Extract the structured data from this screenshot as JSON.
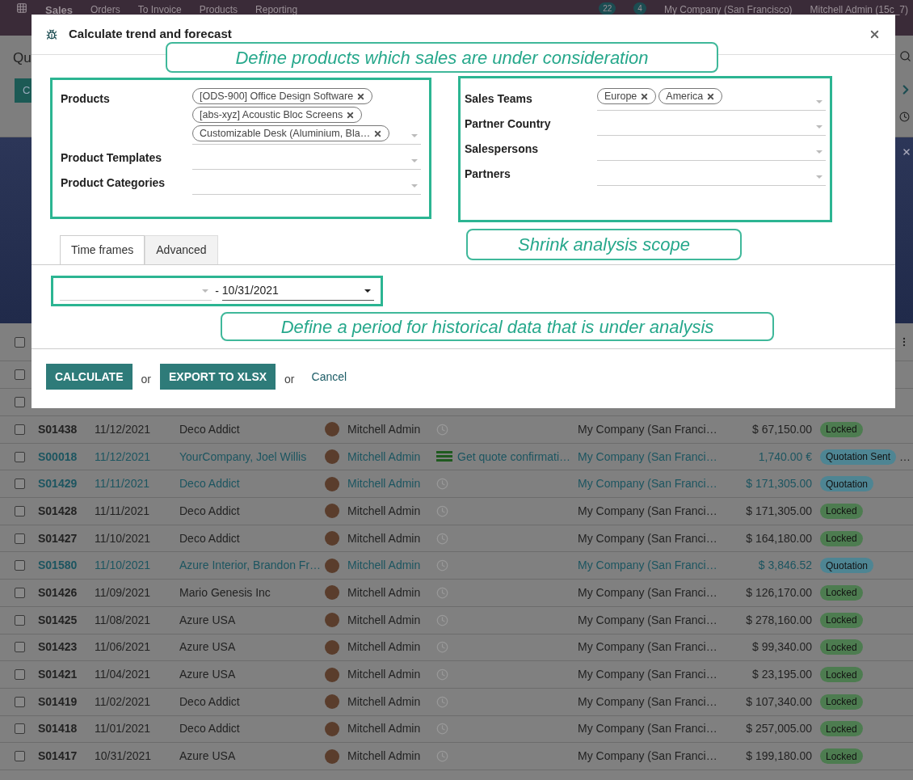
{
  "nav": {
    "app": "Sales",
    "menu": [
      "Orders",
      "To Invoice",
      "Products",
      "Reporting"
    ],
    "discuss_count": "22",
    "activity_count": "4",
    "company": "My Company (San Francisco)",
    "user": "Mitchell Admin (15c_7)"
  },
  "page": {
    "title": "Qu",
    "button": "C"
  },
  "table": {
    "header_checked": false,
    "hidden_rows": [
      {
        "checked": false
      },
      {
        "checked": false
      }
    ],
    "rows": [
      {
        "checked": false,
        "link": false,
        "number": "S01438",
        "date": "11/12/2021",
        "customer": "Deco Addict",
        "salesperson": "Mitchell Admin",
        "company": "My Company (San Franci…",
        "total": "$ 67,150.00",
        "status": "Locked",
        "color": "#4d7c50"
      },
      {
        "checked": false,
        "link": true,
        "number": "S00018",
        "date": "11/12/2021",
        "customer": "YourCompany, Joel Willis",
        "salesperson": "Mitchell Admin",
        "activity": "Get quote confirmati…",
        "company": "My Company (San Franci…",
        "total": "1,740.00 €",
        "status": "Quotation Sent",
        "color": "#4e8593",
        "more": "…"
      },
      {
        "checked": false,
        "link": true,
        "number": "S01429",
        "date": "11/11/2021",
        "customer": "Deco Addict",
        "salesperson": "Mitchell Admin",
        "company": "My Company (San Franci…",
        "total": "$ 171,305.00",
        "status": "Quotation",
        "color": "#4e8593"
      },
      {
        "checked": false,
        "link": false,
        "number": "S01428",
        "date": "11/11/2021",
        "customer": "Deco Addict",
        "salesperson": "Mitchell Admin",
        "company": "My Company (San Franci…",
        "total": "$ 171,305.00",
        "status": "Locked",
        "color": "#4d7c50"
      },
      {
        "checked": false,
        "link": false,
        "number": "S01427",
        "date": "11/10/2021",
        "customer": "Deco Addict",
        "salesperson": "Mitchell Admin",
        "company": "My Company (San Franci…",
        "total": "$ 164,180.00",
        "status": "Locked",
        "color": "#4d7c50"
      },
      {
        "checked": false,
        "link": true,
        "number": "S01580",
        "date": "11/10/2021",
        "customer": "Azure Interior, Brandon Fr…",
        "salesperson": "Mitchell Admin",
        "company": "My Company (San Franci…",
        "total": "$ 3,846.52",
        "status": "Quotation",
        "color": "#4e8593"
      },
      {
        "checked": false,
        "link": false,
        "number": "S01426",
        "date": "11/09/2021",
        "customer": "Mario Genesis Inc",
        "salesperson": "Mitchell Admin",
        "company": "My Company (San Franci…",
        "total": "$ 126,170.00",
        "status": "Locked",
        "color": "#4d7c50"
      },
      {
        "checked": false,
        "link": false,
        "number": "S01425",
        "date": "11/08/2021",
        "customer": "Azure USA",
        "salesperson": "Mitchell Admin",
        "company": "My Company (San Franci…",
        "total": "$ 278,160.00",
        "status": "Locked",
        "color": "#4d7c50"
      },
      {
        "checked": false,
        "link": false,
        "number": "S01423",
        "date": "11/06/2021",
        "customer": "Azure USA",
        "salesperson": "Mitchell Admin",
        "company": "My Company (San Franci…",
        "total": "$ 99,340.00",
        "status": "Locked",
        "color": "#4d7c50"
      },
      {
        "checked": false,
        "link": false,
        "number": "S01421",
        "date": "11/04/2021",
        "customer": "Azure USA",
        "salesperson": "Mitchell Admin",
        "company": "My Company (San Franci…",
        "total": "$ 23,195.00",
        "status": "Locked",
        "color": "#4d7c50"
      },
      {
        "checked": false,
        "link": false,
        "number": "S01419",
        "date": "11/02/2021",
        "customer": "Deco Addict",
        "salesperson": "Mitchell Admin",
        "company": "My Company (San Franci…",
        "total": "$ 107,340.00",
        "status": "Locked",
        "color": "#4d7c50"
      },
      {
        "checked": false,
        "link": false,
        "number": "S01418",
        "date": "11/01/2021",
        "customer": "Deco Addict",
        "salesperson": "Mitchell Admin",
        "company": "My Company (San Franci…",
        "total": "$ 257,005.00",
        "status": "Locked",
        "color": "#4d7c50"
      },
      {
        "checked": false,
        "link": false,
        "number": "S01417",
        "date": "10/31/2021",
        "customer": "Azure USA",
        "salesperson": "Mitchell Admin",
        "company": "My Company (San Franci…",
        "total": "$ 199,180.00",
        "status": "Locked",
        "color": "#4d7c50"
      }
    ]
  },
  "dialog": {
    "title": "Calculate trend and forecast",
    "left_fields": [
      {
        "label": "Products",
        "tags": [
          "[ODS-900] Office Design Software",
          "[abs-xyz] Acoustic Bloc Screens",
          "Customizable Desk (Aluminium, Bla…"
        ]
      },
      {
        "label": "Product Templates"
      },
      {
        "label": "Product Categories"
      }
    ],
    "right_fields": [
      {
        "label": "Sales Teams",
        "tags": [
          "Europe",
          "America"
        ]
      },
      {
        "label": "Partner Country"
      },
      {
        "label": "Salespersons"
      },
      {
        "label": "Partners"
      }
    ],
    "tabs": [
      {
        "label": "Time frames",
        "selected": true
      },
      {
        "label": "Advanced",
        "selected": false
      }
    ],
    "date_separator": "-",
    "date_to": "10/31/2021",
    "buttons": [
      {
        "label": "CALCULATE",
        "kind": "primary"
      },
      {
        "label": "or",
        "kind": "text"
      },
      {
        "label": "EXPORT TO XLSX",
        "kind": "primary"
      },
      {
        "label": "or",
        "kind": "text"
      },
      {
        "label": "Cancel",
        "kind": "link"
      }
    ]
  },
  "callouts": [
    "Define products which sales are under consideration",
    "Shrink analysis scope",
    "Define a period for historical data that is under analysis"
  ]
}
